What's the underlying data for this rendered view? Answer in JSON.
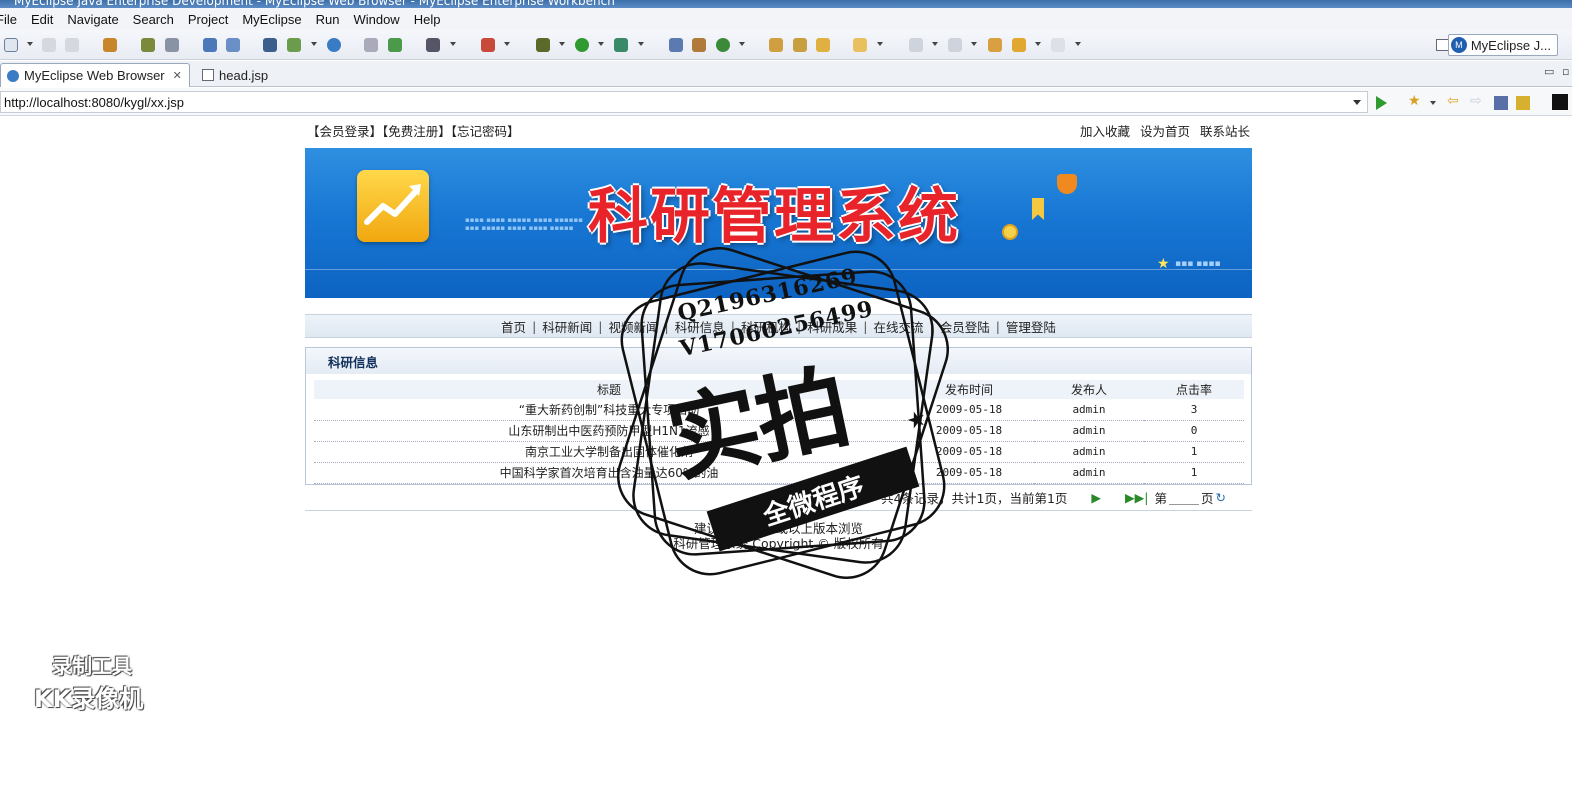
{
  "window": {
    "title": "MyEclipse Java Enterprise Development - MyEclipse Web Browser - MyEclipse Enterprise Workbench"
  },
  "menu": [
    "File",
    "Edit",
    "Navigate",
    "Search",
    "Project",
    "MyEclipse",
    "Run",
    "Window",
    "Help"
  ],
  "perspective": {
    "label": "MyEclipse J..."
  },
  "tabs": [
    {
      "label": "MyEclipse Web Browser",
      "close": "✕"
    },
    {
      "label": "head.jsp"
    }
  ],
  "url": "http://localhost:8080/kygl/xx.jsp",
  "site": {
    "top_left": [
      "【会员登录】",
      "【免费注册】",
      "【忘记密码】"
    ],
    "top_right": [
      "加入收藏",
      "设为首页",
      "联系站长"
    ],
    "banner_title": "科研管理系统",
    "nav": [
      "首页",
      "科研新闻",
      "视频新闻",
      "科研信息",
      "科研机构",
      "科研成果",
      "在线交流",
      "会员登陆",
      "管理登陆"
    ],
    "section_title": "科研信息",
    "table": {
      "headers": [
        "标题",
        "发布时间",
        "发布人",
        "点击率"
      ],
      "rows": [
        [
          "“重大新药创制”科技重大专项启动",
          "2009-05-18",
          "admin",
          "3"
        ],
        [
          "山东研制出中医药预防甲型H1N1流感",
          "2009-05-18",
          "admin",
          "0"
        ],
        [
          "南京工业大学制备出固体催化剂",
          "2009-05-18",
          "admin",
          "1"
        ],
        [
          "中国科学家首次培育出含油量达60%的油",
          "2009-05-18",
          "admin",
          "1"
        ]
      ]
    },
    "pager": {
      "summary": "共4条记录，共计1页，当前第1页",
      "go_prefix": "第",
      "go_suffix": "页"
    },
    "footer": [
      "建议使用IE6.0或以上版本浏览",
      "科研管理系统 Copyright © 版权所有"
    ]
  },
  "watermark": {
    "line1": "Q2196316269",
    "line2": "V17060256499",
    "big": "实拍",
    "ribbon": "全微程序",
    "recorder1": "录制工具",
    "recorder2": "KK录像机"
  }
}
